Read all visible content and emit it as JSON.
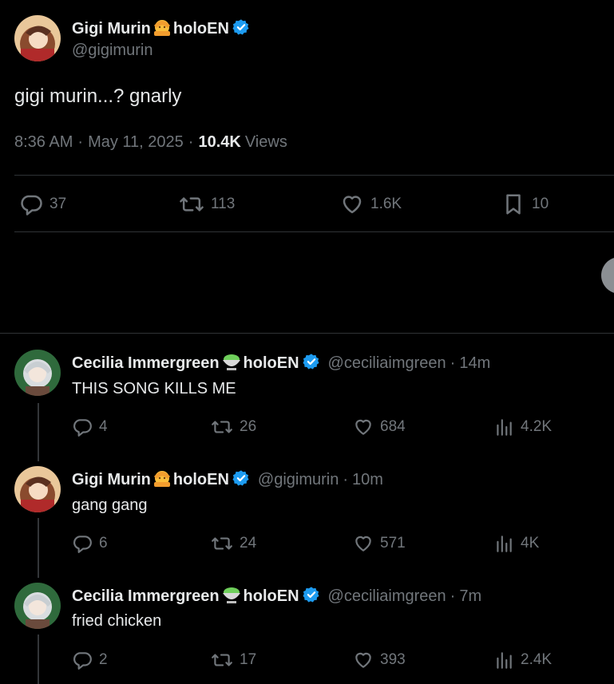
{
  "main_tweet": {
    "author_name": "Gigi Murin",
    "author_suffix": "holoEN",
    "handle": "@gigimurin",
    "text": "gigi murin...? gnarly",
    "time": "8:36 AM",
    "date": "May 11, 2025",
    "views_count": "10.4K",
    "views_label": "Views",
    "replies": "37",
    "retweets": "113",
    "likes": "1.6K",
    "bookmarks": "10"
  },
  "replies": [
    {
      "author_name": "Cecilia Immergreen",
      "author_suffix": "holoEN",
      "handle": "@ceciliaimgreen",
      "time": "14m",
      "text": "THIS SONG KILLS ME",
      "replies": "4",
      "retweets": "26",
      "likes": "684",
      "views": "4.2K"
    },
    {
      "author_name": "Gigi Murin",
      "author_suffix": "holoEN",
      "handle": "@gigimurin",
      "time": "10m",
      "text": "gang gang",
      "replies": "6",
      "retweets": "24",
      "likes": "571",
      "views": "4K"
    },
    {
      "author_name": "Cecilia Immergreen",
      "author_suffix": "holoEN",
      "handle": "@ceciliaimgreen",
      "time": "7m",
      "text": "fried chicken",
      "replies": "2",
      "retweets": "17",
      "likes": "393",
      "views": "2.4K"
    }
  ],
  "colors": {
    "background": "#000000",
    "text": "#e7e9ea",
    "muted": "#71767b",
    "verified": "#1d9bf0",
    "divider": "#2f3336"
  },
  "icons": [
    "reply-icon",
    "retweet-icon",
    "like-icon",
    "bookmark-icon",
    "views-icon",
    "verified-icon",
    "emoji-icon"
  ]
}
